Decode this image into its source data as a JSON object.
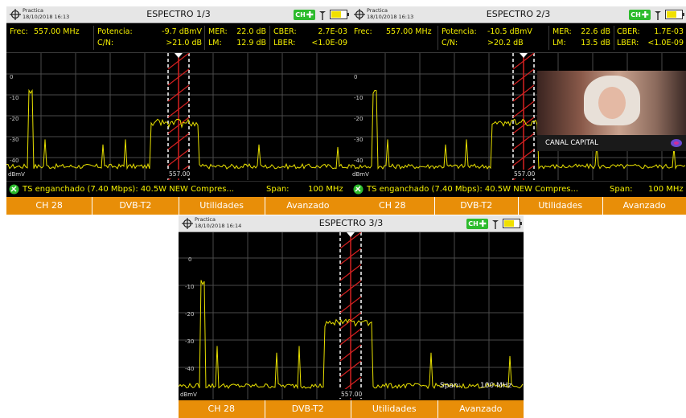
{
  "colors": {
    "accent": "#e88e08",
    "trace": "#e8e000",
    "text": "#f5f000",
    "marker": "#d42020",
    "ok": "#2dbb2d"
  },
  "common": {
    "frequency_label": "Frec:",
    "frequency_value": "557.00 MHz",
    "power_label": "Potencia:",
    "cn_label": "C/N:",
    "mer_label": "MER:",
    "lm_label": "LM:",
    "cber_label": "CBER:",
    "lber_label": "LBER:",
    "ch_badge": "CH",
    "span_label": "Span:",
    "span_value": "100 MHz",
    "unit_label": "dBmV",
    "center_label": "557.00",
    "y_ticks": [
      "0",
      "-10",
      "-20",
      "-30",
      "-40"
    ],
    "ts_status": "TS enganchado (7.40 Mbps): 40.5W NEW Compres...",
    "softkeys": [
      "CH 28",
      "DVB-T2",
      "Utilidades",
      "Avanzado"
    ]
  },
  "panels": [
    {
      "location": "Practica",
      "datetime": "18/10/2018 16:13",
      "title": "ESPECTRO 1/3",
      "power": "-9.7 dBmV",
      "cn": ">21.0 dB",
      "mer": "22.0 dB",
      "lm": "12.9 dB",
      "cber": "2.7E-03",
      "lber": "<1.0E-09"
    },
    {
      "location": "Practica",
      "datetime": "18/10/2018 16:13",
      "title": "ESPECTRO 2/3",
      "power": "-10.5 dBmV",
      "cn": ">20.2 dB",
      "mer": "22.6 dB",
      "lm": "13.5 dB",
      "cber": "1.7E-03",
      "lber": "<1.0E-09",
      "video_channel": "CANAL CAPITAL"
    },
    {
      "location": "Practica",
      "datetime": "18/10/2018 16:14",
      "title": "ESPECTRO 3/3"
    }
  ]
}
